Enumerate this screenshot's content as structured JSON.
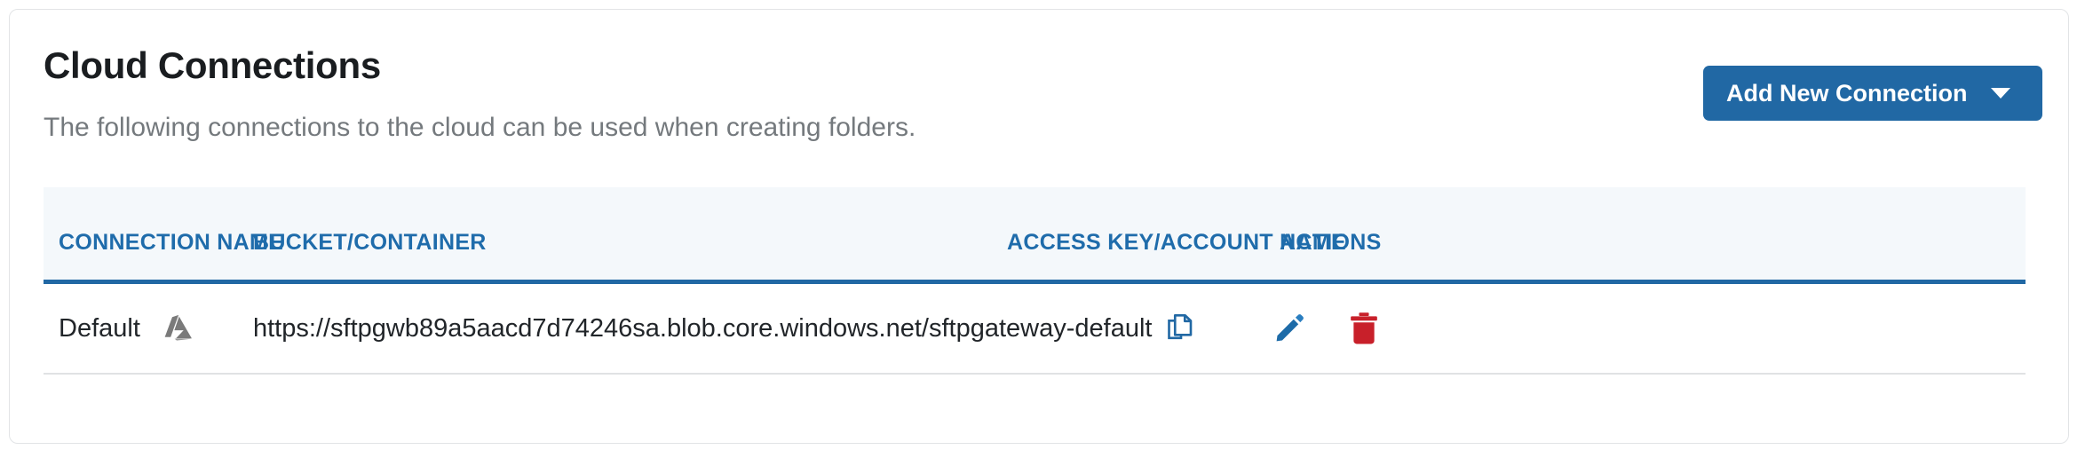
{
  "card": {
    "title": "Cloud Connections",
    "subtitle": "The following connections to the cloud can be used when creating folders.",
    "add_button": {
      "label": "Add New Connection",
      "caret_icon": "chevron-down-icon",
      "color": "#2168a4"
    }
  },
  "table": {
    "accent_color": "#2168a4",
    "header_background": "#f4f8fb",
    "columns": [
      {
        "key": "connection_name",
        "label": "CONNECTION NAME"
      },
      {
        "key": "bucket_container",
        "label": "BUCKET/CONTAINER"
      },
      {
        "key": "access_key",
        "label": "ACCESS KEY/ACCOUNT NAME"
      },
      {
        "key": "actions",
        "label": "ACTIONS"
      }
    ],
    "rows": [
      {
        "connection_name": "Default",
        "provider_icon": "azure-logo-icon",
        "provider_icon_color": "#7a7a7a",
        "bucket_container": "https://sftpgwb89a5aacd7d74246sa.blob.core.windows.net/sftpgateway-default",
        "copy_icon": "copy-icon",
        "copy_icon_color": "#2168a4",
        "access_key": "",
        "actions": {
          "edit_icon": "pencil-icon",
          "edit_icon_color": "#1d6ba8",
          "delete_icon": "trash-icon",
          "delete_icon_color": "#c8202a"
        }
      }
    ]
  }
}
